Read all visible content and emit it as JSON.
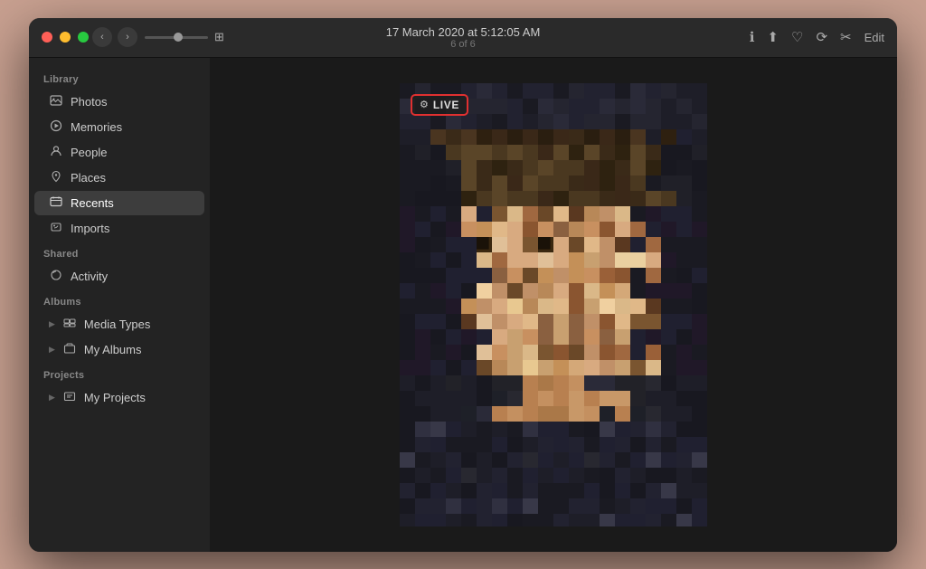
{
  "window": {
    "title": "17 March 2020 at 5:12:05 AM",
    "subtitle": "6 of 6"
  },
  "traffic_lights": {
    "close": "close",
    "minimize": "minimize",
    "maximize": "maximize"
  },
  "toolbar": {
    "back_label": "‹",
    "forward_label": "›",
    "info_icon": "ℹ",
    "share_icon": "⬆",
    "heart_icon": "♡",
    "rotate_icon": "⟳",
    "tools_icon": "✂",
    "edit_label": "Edit"
  },
  "live_badge": {
    "icon": "⚙",
    "label": "LIVE"
  },
  "sidebar": {
    "library_label": "Library",
    "shared_label": "Shared",
    "albums_label": "Albums",
    "projects_label": "Projects",
    "items": [
      {
        "id": "photos",
        "label": "Photos",
        "icon": "🖼",
        "active": false
      },
      {
        "id": "memories",
        "label": "Memories",
        "icon": "▶",
        "active": false
      },
      {
        "id": "people",
        "label": "People",
        "icon": "👤",
        "active": false
      },
      {
        "id": "places",
        "label": "Places",
        "icon": "📍",
        "active": false
      },
      {
        "id": "recents",
        "label": "Recents",
        "icon": "🕐",
        "active": true
      },
      {
        "id": "imports",
        "label": "Imports",
        "icon": "📷",
        "active": false
      },
      {
        "id": "activity",
        "label": "Activity",
        "icon": "☁",
        "active": false
      },
      {
        "id": "media-types",
        "label": "Media Types",
        "icon": "▶",
        "active": false,
        "group": "albums"
      },
      {
        "id": "my-albums",
        "label": "My Albums",
        "icon": "▶",
        "active": false,
        "group": "albums"
      },
      {
        "id": "my-projects",
        "label": "My Projects",
        "icon": "▶",
        "active": false,
        "group": "projects"
      }
    ]
  }
}
